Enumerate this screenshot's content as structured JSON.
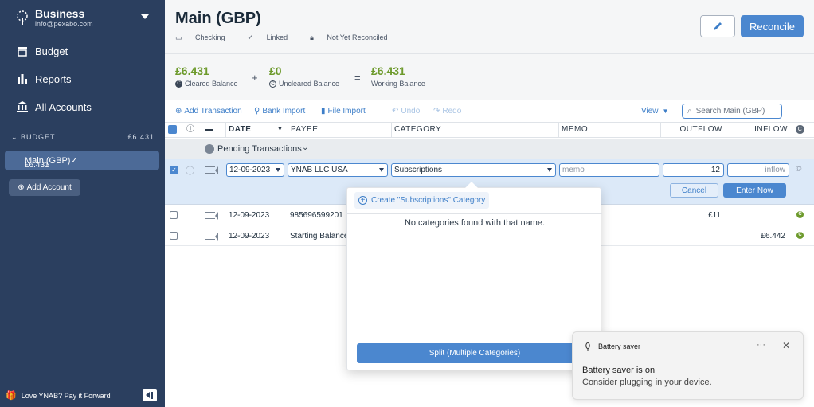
{
  "sidebar": {
    "budget_name": "Business",
    "email": "info@pexabo.com",
    "nav": [
      {
        "label": "Budget",
        "icon": "budget-icon"
      },
      {
        "label": "Reports",
        "icon": "reports-icon"
      },
      {
        "label": "All Accounts",
        "icon": "bank-icon"
      }
    ],
    "section_label": "BUDGET",
    "section_balance": "£6.431",
    "account": {
      "name": "Main (GBP)",
      "balance": "£6.431"
    },
    "add_account_label": "Add Account",
    "footer_label": "Love YNAB? Pay it Forward"
  },
  "header": {
    "title": "Main (GBP)",
    "meta": [
      "Checking",
      "Linked",
      "Not Yet Reconciled"
    ],
    "reconcile_label": "Reconcile"
  },
  "balances": {
    "cleared": {
      "value": "£6.431",
      "label": "Cleared Balance"
    },
    "uncleared": {
      "value": "£0",
      "label": "Uncleared Balance"
    },
    "working": {
      "value": "£6.431",
      "label": "Working Balance"
    },
    "plus": "+",
    "equals": "="
  },
  "toolbar": {
    "add_transaction": "Add Transaction",
    "bank_import": "Bank Import",
    "file_import": "File Import",
    "undo": "Undo",
    "redo": "Redo",
    "view": "View",
    "search_placeholder": "Search Main (GBP)"
  },
  "columns": {
    "date": "DATE",
    "payee": "PAYEE",
    "category": "CATEGORY",
    "memo": "MEMO",
    "outflow": "OUTFLOW",
    "inflow": "INFLOW"
  },
  "pending_label": "Pending Transactions",
  "edit_row": {
    "date": "12-09-2023",
    "payee": "YNAB LLC USA",
    "category": "Subscriptions",
    "memo_placeholder": "memo",
    "outflow": "12",
    "inflow_placeholder": "inflow",
    "cancel_label": "Cancel",
    "enter_label": "Enter Now"
  },
  "transactions": [
    {
      "date": "12-09-2023",
      "payee": "985696599201",
      "outflow": "£11",
      "inflow": ""
    },
    {
      "date": "12-09-2023",
      "payee": "Starting Balance",
      "outflow": "",
      "inflow": "£6.442"
    }
  ],
  "dropdown": {
    "create_label": "Create \"Subscriptions\" Category",
    "empty_message": "No categories found with that name.",
    "split_label": "Split (Multiple Categories)"
  },
  "toast": {
    "app": "Battery saver",
    "title": "Battery saver is on",
    "body": "Consider plugging in your device.",
    "more": "···",
    "close": "✕"
  },
  "colors": {
    "sidebar": "#2b3f5f",
    "accent": "#4b87cf",
    "positive": "#6d9a2c"
  }
}
